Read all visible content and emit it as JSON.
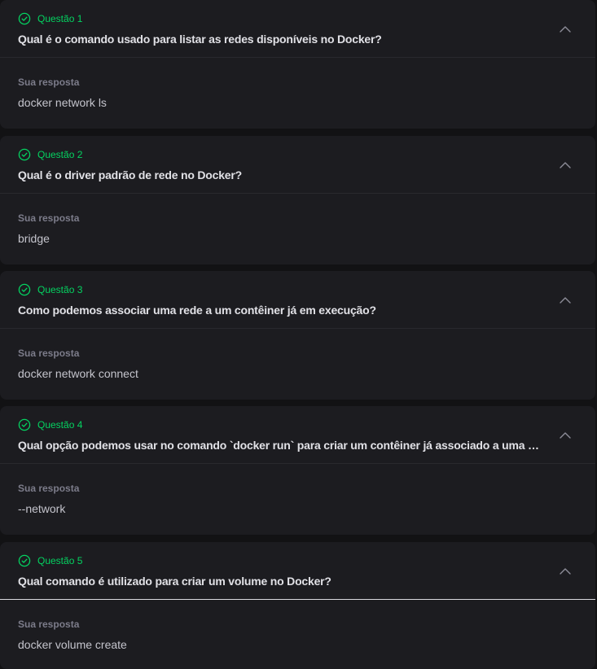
{
  "accent_color": "#04d361",
  "answer_label": "Sua resposta",
  "questions": [
    {
      "status": "Questão 1",
      "status_icon": "check-circle-icon",
      "title": "Qual é o comando usado para listar as redes disponíveis no Docker?",
      "answer": "docker network ls",
      "expanded": true
    },
    {
      "status": "Questão 2",
      "status_icon": "check-circle-icon",
      "title": "Qual é o driver padrão de rede no Docker?",
      "answer": "bridge",
      "expanded": true
    },
    {
      "status": "Questão 3",
      "status_icon": "check-circle-icon",
      "title": "Como podemos associar uma rede a um contêiner já em execução?",
      "answer": "docker network connect",
      "expanded": true
    },
    {
      "status": "Questão 4",
      "status_icon": "check-circle-icon",
      "title": "Qual opção podemos usar no comando `docker run` para criar um contêiner já associado a uma rede?",
      "answer": "--network",
      "expanded": true
    },
    {
      "status": "Questão 5",
      "status_icon": "check-circle-icon",
      "title": "Qual comando é utilizado para criar um volume no Docker?",
      "answer": "docker volume create",
      "expanded": true
    }
  ]
}
